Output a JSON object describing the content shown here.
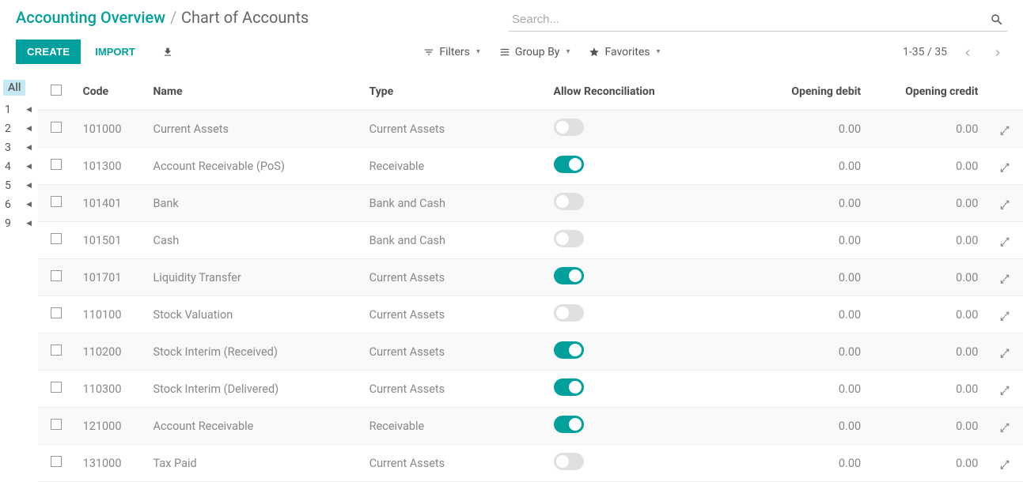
{
  "breadcrumb": {
    "parent": "Accounting Overview",
    "current": "Chart of Accounts"
  },
  "search": {
    "placeholder": "Search..."
  },
  "actions": {
    "create": "CREATE",
    "import": "IMPORT"
  },
  "filters": {
    "filters": "Filters",
    "group_by": "Group By",
    "favorites": "Favorites"
  },
  "pager": {
    "range": "1-35 / 35"
  },
  "side_index": {
    "all": "All",
    "items": [
      "1",
      "2",
      "3",
      "4",
      "5",
      "6",
      "9"
    ]
  },
  "columns": {
    "code": "Code",
    "name": "Name",
    "type": "Type",
    "reconcile": "Allow Reconciliation",
    "opening_debit": "Opening debit",
    "opening_credit": "Opening credit"
  },
  "rows": [
    {
      "code": "101000",
      "name": "Current Assets",
      "type": "Current Assets",
      "reconcile": false,
      "debit": "0.00",
      "credit": "0.00"
    },
    {
      "code": "101300",
      "name": "Account Receivable (PoS)",
      "type": "Receivable",
      "reconcile": true,
      "debit": "0.00",
      "credit": "0.00"
    },
    {
      "code": "101401",
      "name": "Bank",
      "type": "Bank and Cash",
      "reconcile": false,
      "debit": "0.00",
      "credit": "0.00"
    },
    {
      "code": "101501",
      "name": "Cash",
      "type": "Bank and Cash",
      "reconcile": false,
      "debit": "0.00",
      "credit": "0.00"
    },
    {
      "code": "101701",
      "name": "Liquidity Transfer",
      "type": "Current Assets",
      "reconcile": true,
      "debit": "0.00",
      "credit": "0.00"
    },
    {
      "code": "110100",
      "name": "Stock Valuation",
      "type": "Current Assets",
      "reconcile": false,
      "debit": "0.00",
      "credit": "0.00"
    },
    {
      "code": "110200",
      "name": "Stock Interim (Received)",
      "type": "Current Assets",
      "reconcile": true,
      "debit": "0.00",
      "credit": "0.00"
    },
    {
      "code": "110300",
      "name": "Stock Interim (Delivered)",
      "type": "Current Assets",
      "reconcile": true,
      "debit": "0.00",
      "credit": "0.00"
    },
    {
      "code": "121000",
      "name": "Account Receivable",
      "type": "Receivable",
      "reconcile": true,
      "debit": "0.00",
      "credit": "0.00"
    },
    {
      "code": "131000",
      "name": "Tax Paid",
      "type": "Current Assets",
      "reconcile": false,
      "debit": "0.00",
      "credit": "0.00"
    }
  ]
}
